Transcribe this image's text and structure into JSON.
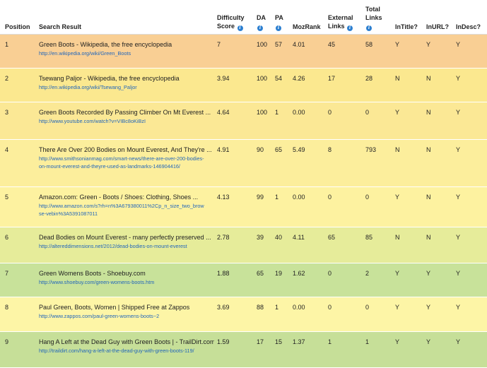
{
  "headers": {
    "position": "Position",
    "search_result": "Search Result",
    "difficulty_line1": "Difficulty",
    "difficulty_line2": "Score",
    "da": "DA",
    "pa": "PA",
    "mozrank": "MozRank",
    "external_line1": "External",
    "external_line2": "Links",
    "total_line1": "Total",
    "total_line2": "Links",
    "intitle": "InTitle?",
    "inurl": "InURL?",
    "indesc": "InDesc?"
  },
  "info_glyph": "i",
  "colors": {
    "row1": "#f9cf94",
    "row2": "#fbe88f",
    "row3": "#fbe895",
    "row4": "#fcee9c",
    "row5": "#fdf2a0",
    "row6": "#e6ec9a",
    "row7": "#c8e29a",
    "row8": "#fdf5a6",
    "row9": "#c6df98",
    "link": "#2266bb",
    "info_icon": "#2c7fd0"
  },
  "rows": [
    {
      "position": "1",
      "title": "Green Boots - Wikipedia, the free encyclopedia",
      "url": "http://en.wikipedia.org/wiki/Green_Boots",
      "difficulty": "7",
      "da": "100",
      "pa": "57",
      "mozrank": "4.01",
      "external": "45",
      "total": "58",
      "intitle": "Y",
      "inurl": "Y",
      "indesc": "Y"
    },
    {
      "position": "2",
      "title": "Tsewang Paljor - Wikipedia, the free encyclopedia",
      "url": "http://en.wikipedia.org/wiki/Tsewang_Paljor",
      "difficulty": "3.94",
      "da": "100",
      "pa": "54",
      "mozrank": "4.26",
      "external": "17",
      "total": "28",
      "intitle": "N",
      "inurl": "N",
      "indesc": "Y"
    },
    {
      "position": "3",
      "title": "Green Boots Recorded By Passing Climber On Mt Everest ...",
      "url": "http://www.youtube.com/watch?v=VIBc8oKiBzI",
      "difficulty": "4.64",
      "da": "100",
      "pa": "1",
      "mozrank": "0.00",
      "external": "0",
      "total": "0",
      "intitle": "Y",
      "inurl": "N",
      "indesc": "Y"
    },
    {
      "position": "4",
      "title": "There Are Over 200 Bodies on Mount Everest, And They're ...",
      "url": "http://www.smithsonianmag.com/smart-news/there-are-over-200-bodies-on-mount-everest-and-theyre-used-as-landmarks-146904416/",
      "difficulty": "4.91",
      "da": "90",
      "pa": "65",
      "mozrank": "5.49",
      "external": "8",
      "total": "793",
      "intitle": "N",
      "inurl": "N",
      "indesc": "Y"
    },
    {
      "position": "5",
      "title": "Amazon.com: Green - Boots / Shoes: Clothing, Shoes ...",
      "url": "http://www.amazon.com/s?rh=n%3A679380011%2Cp_n_size_two_browse-vebin%3A5391087011",
      "difficulty": "4.13",
      "da": "99",
      "pa": "1",
      "mozrank": "0.00",
      "external": "0",
      "total": "0",
      "intitle": "Y",
      "inurl": "N",
      "indesc": "Y"
    },
    {
      "position": "6",
      "title": "Dead Bodies on Mount Everest - many perfectly preserved ...",
      "url": "http://altereddimensions.net/2012/dead-bodies-on-mount-everest",
      "difficulty": "2.78",
      "da": "39",
      "pa": "40",
      "mozrank": "4.11",
      "external": "65",
      "total": "85",
      "intitle": "N",
      "inurl": "N",
      "indesc": "Y"
    },
    {
      "position": "7",
      "title": "Green Womens Boots - Shoebuy.com",
      "url": "http://www.shoebuy.com/green-womens-boots.htm",
      "difficulty": "1.88",
      "da": "65",
      "pa": "19",
      "mozrank": "1.62",
      "external": "0",
      "total": "2",
      "intitle": "Y",
      "inurl": "Y",
      "indesc": "Y"
    },
    {
      "position": "8",
      "title": "Paul Green, Boots, Women | Shipped Free at Zappos",
      "url": "http://www.zappos.com/paul-green-womens-boots~2",
      "difficulty": "3.69",
      "da": "88",
      "pa": "1",
      "mozrank": "0.00",
      "external": "0",
      "total": "0",
      "intitle": "Y",
      "inurl": "Y",
      "indesc": "Y"
    },
    {
      "position": "9",
      "title": "Hang A Left at the Dead Guy with Green Boots | - TrailDirt.com",
      "url": "http://traildirt.com/hang-a-left-at-the-dead-guy-with-green-boots-119/",
      "difficulty": "1.59",
      "da": "17",
      "pa": "15",
      "mozrank": "1.37",
      "external": "1",
      "total": "1",
      "intitle": "Y",
      "inurl": "Y",
      "indesc": "Y"
    }
  ]
}
